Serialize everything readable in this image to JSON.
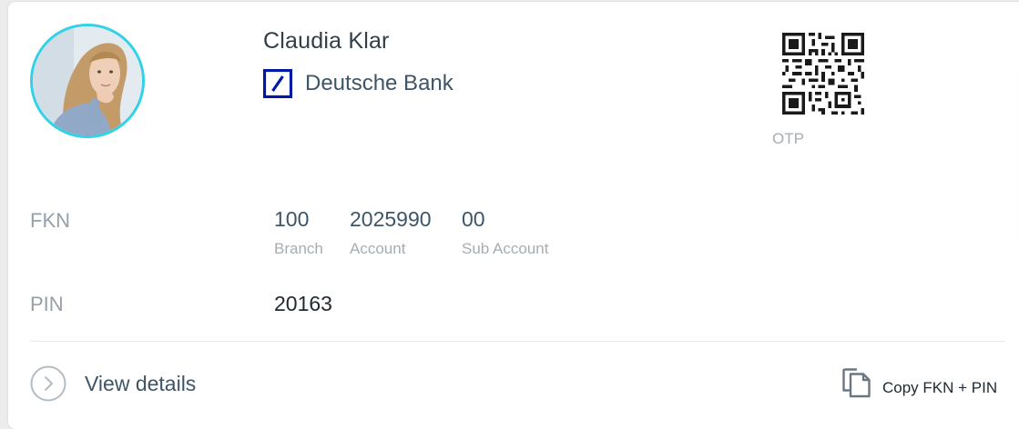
{
  "profile": {
    "name": "Claudia Klar",
    "bank_name": "Deutsche Bank",
    "avatar_icon": "person-photo",
    "bank_logo_icon": "deutsche-bank-logo",
    "accent_color": "#2fd2e6"
  },
  "otp": {
    "label": "OTP",
    "icon": "qr-code"
  },
  "fkn": {
    "label": "FKN",
    "parts": [
      {
        "value": "100",
        "caption": "Branch"
      },
      {
        "value": "2025990",
        "caption": "Account"
      },
      {
        "value": "00",
        "caption": "Sub Account"
      }
    ]
  },
  "pin": {
    "label": "PIN",
    "value": "20163"
  },
  "actions": {
    "view_details": "View details",
    "copy": "Copy FKN + PIN"
  }
}
